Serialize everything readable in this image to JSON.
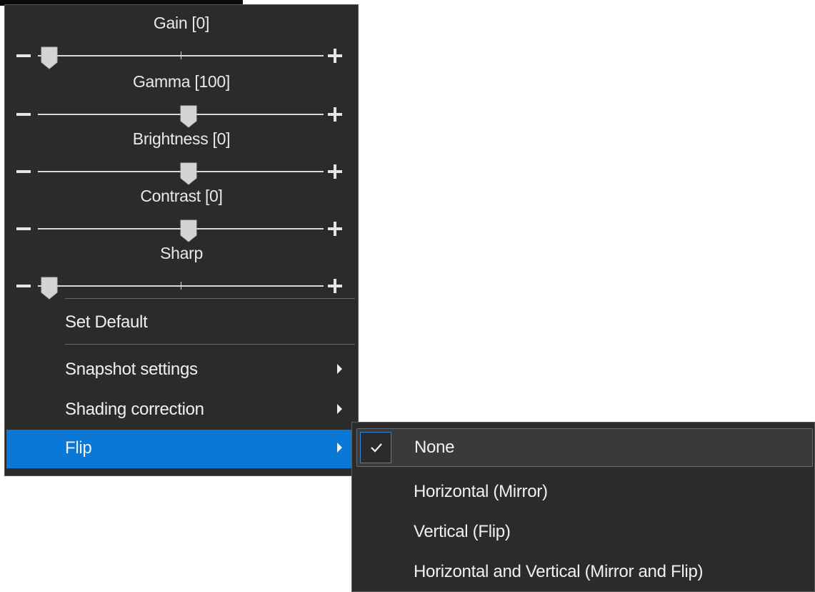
{
  "sliders": [
    {
      "label": "Gain [0]",
      "position": 0.0
    },
    {
      "label": "Gamma [100]",
      "position": 0.5
    },
    {
      "label": "Brightness [0]",
      "position": 0.5
    },
    {
      "label": "Contrast [0]",
      "position": 0.5
    },
    {
      "label": "Sharp",
      "position": 0.0
    }
  ],
  "menu": {
    "set_default": "Set Default",
    "snapshot_settings": "Snapshot settings",
    "shading_correction": "Shading correction",
    "flip": "Flip"
  },
  "flip_submenu": {
    "items": [
      {
        "label": "None",
        "checked": true
      },
      {
        "label": "Horizontal (Mirror)",
        "checked": false
      },
      {
        "label": "Vertical (Flip)",
        "checked": false
      },
      {
        "label": "Horizontal and Vertical (Mirror and Flip)",
        "checked": false
      }
    ]
  },
  "colors": {
    "menu_bg": "#2b2b2b",
    "highlight": "#0a78d4",
    "check_border": "#2e8ad8"
  },
  "icons": {
    "decrease": "minus-icon",
    "increase": "plus-icon",
    "submenu": "chevron-right-icon",
    "check": "checkmark-icon"
  }
}
